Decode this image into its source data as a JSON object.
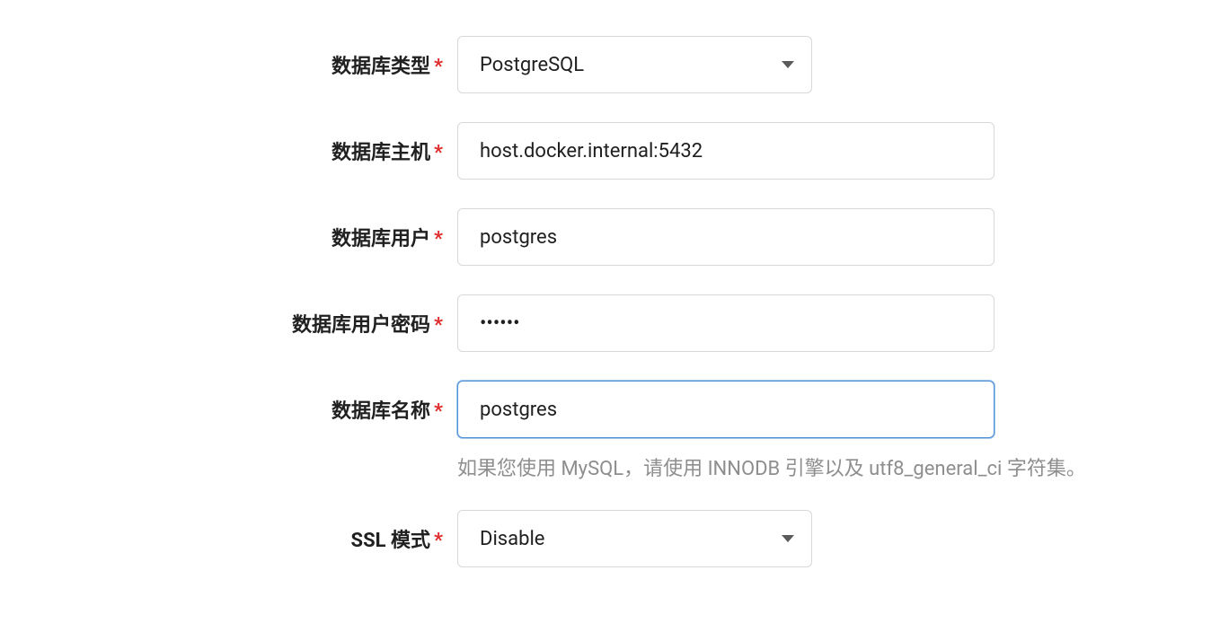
{
  "fields": {
    "db_type": {
      "label": "数据库类型",
      "value": "PostgreSQL"
    },
    "db_host": {
      "label": "数据库主机",
      "value": "host.docker.internal:5432"
    },
    "db_user": {
      "label": "数据库用户",
      "value": "postgres"
    },
    "db_password": {
      "label": "数据库用户密码",
      "value": "••••••"
    },
    "db_name": {
      "label": "数据库名称",
      "value": "postgres",
      "help": "如果您使用 MySQL，请使用 INNODB 引擎以及 utf8_general_ci 字符集。"
    },
    "ssl_mode": {
      "label": "SSL 模式",
      "value": "Disable"
    }
  },
  "required_mark": "*"
}
